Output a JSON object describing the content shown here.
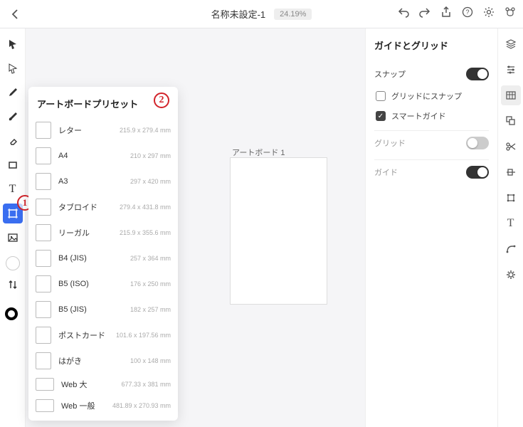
{
  "topbar": {
    "title": "名称未設定-1",
    "zoom": "24.19%"
  },
  "annotations": {
    "one": "1",
    "two": "2"
  },
  "canvas": {
    "artboard_label": "アートボード 1"
  },
  "preset_panel": {
    "title": "アートボードプリセット",
    "items": [
      {
        "name": "レター",
        "dims": "215.9 x 279.4  mm",
        "land": false
      },
      {
        "name": "A4",
        "dims": "210 x 297  mm",
        "land": false
      },
      {
        "name": "A3",
        "dims": "297 x 420  mm",
        "land": false
      },
      {
        "name": "タブロイド",
        "dims": "279.4 x 431.8  mm",
        "land": false
      },
      {
        "name": "リーガル",
        "dims": "215.9 x 355.6  mm",
        "land": false
      },
      {
        "name": "B4 (JIS)",
        "dims": "257 x 364  mm",
        "land": false
      },
      {
        "name": "B5 (ISO)",
        "dims": "176 x 250  mm",
        "land": false
      },
      {
        "name": "B5 (JIS)",
        "dims": "182 x 257  mm",
        "land": false
      },
      {
        "name": "ポストカード",
        "dims": "101.6 x 197.56  mm",
        "land": false
      },
      {
        "name": "はがき",
        "dims": "100 x 148  mm",
        "land": false
      },
      {
        "name": "Web 大",
        "dims": "677.33 x 381  mm",
        "land": true
      },
      {
        "name": "Web 一般",
        "dims": "481.89 x 270.93  mm",
        "land": true
      }
    ]
  },
  "right_panel": {
    "title": "ガイドとグリッド",
    "snap_label": "スナップ",
    "snap_on": true,
    "snap_grid_label": "グリッドにスナップ",
    "snap_grid_on": false,
    "smart_guide_label": "スマートガイド",
    "smart_guide_on": true,
    "grid_label": "グリッド",
    "grid_on": false,
    "guide_label": "ガイド",
    "guide_on": true
  }
}
